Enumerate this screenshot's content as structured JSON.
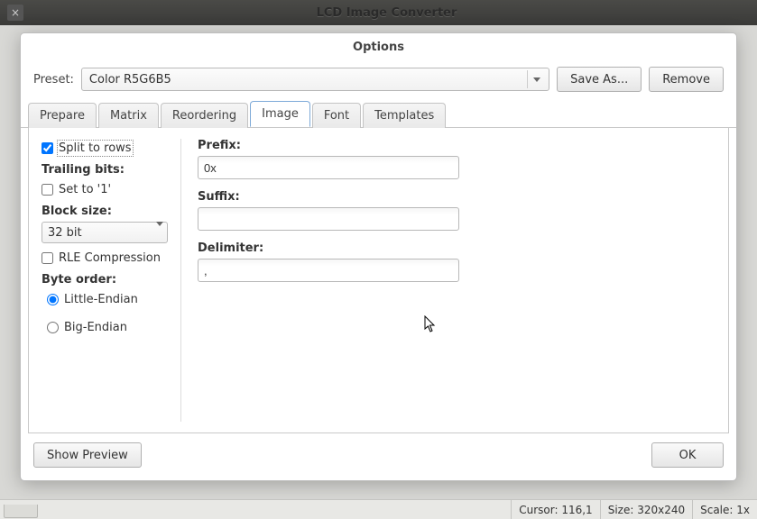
{
  "window": {
    "title": "LCD Image Converter"
  },
  "dialog": {
    "title": "Options"
  },
  "preset": {
    "label": "Preset:",
    "value": "Color R5G6B5",
    "save_as": "Save As...",
    "remove": "Remove"
  },
  "tabs": [
    "Prepare",
    "Matrix",
    "Reordering",
    "Image",
    "Font",
    "Templates"
  ],
  "active_tab": "Image",
  "image_tab": {
    "split_rows": "Split to rows",
    "split_rows_checked": true,
    "trailing_bits_label": "Trailing bits:",
    "set_to_1": "Set to '1'",
    "set_to_1_checked": false,
    "block_size_label": "Block size:",
    "block_size_value": "32 bit",
    "rle": "RLE Compression",
    "rle_checked": false,
    "byte_order_label": "Byte order:",
    "endian_little": "Little-Endian",
    "endian_big": "Big-Endian",
    "endian_value": "little",
    "prefix_label": "Prefix:",
    "prefix_value": "0x",
    "suffix_label": "Suffix:",
    "suffix_value": "",
    "delimiter_label": "Delimiter:",
    "delimiter_value": ","
  },
  "footer": {
    "show_preview": "Show Preview",
    "ok": "OK"
  },
  "statusbar": {
    "cursor": "Cursor: 116,1",
    "size": "Size: 320x240",
    "scale": "Scale: 1x"
  }
}
